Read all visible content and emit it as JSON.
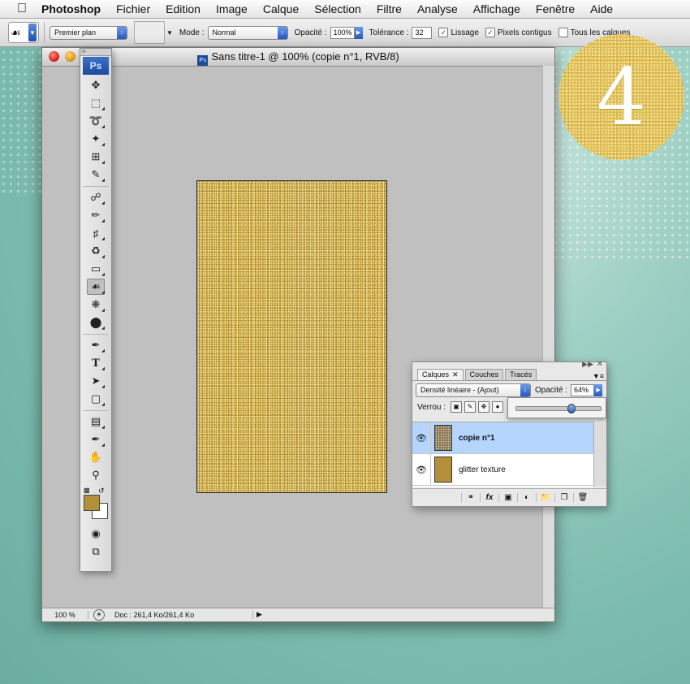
{
  "menubar": {
    "app": "Photoshop",
    "items": [
      "Fichier",
      "Edition",
      "Image",
      "Calque",
      "Sélection",
      "Filtre",
      "Analyse",
      "Affichage",
      "Fenêtre",
      "Aide"
    ]
  },
  "options": {
    "fill_source": "Premier plan",
    "mode_label": "Mode :",
    "mode_value": "Normal",
    "opacity_label": "Opacité :",
    "opacity_value": "100%",
    "tolerance_label": "Tolérance :",
    "tolerance_value": "32",
    "antialias_label": "Lissage",
    "contiguous_label": "Pixels contigus",
    "all_layers_label": "Tous les calques"
  },
  "document": {
    "title": "Sans titre-1 @ 100% (copie n°1, RVB/8)",
    "zoom": "100 %",
    "doc_info": "Doc : 261,4 Ko/261,4 Ko"
  },
  "tools": {
    "logo": "Ps",
    "foreground_color": "#b5903a",
    "background_color": "#ffffff"
  },
  "layers_panel": {
    "tabs": [
      "Calques",
      "Couches",
      "Tracés"
    ],
    "blend_mode": "Densité linéaire - (Ajout)",
    "opacity_label": "Opacité :",
    "opacity_value": "64%",
    "opacity_fraction": 0.64,
    "lock_label": "Verrou :",
    "layers": [
      {
        "name": "copie n°1",
        "selected": true,
        "visible": true
      },
      {
        "name": "glitter texture",
        "selected": false,
        "visible": true
      }
    ]
  },
  "badge": {
    "number": "4",
    "color": "#e2c25a"
  }
}
